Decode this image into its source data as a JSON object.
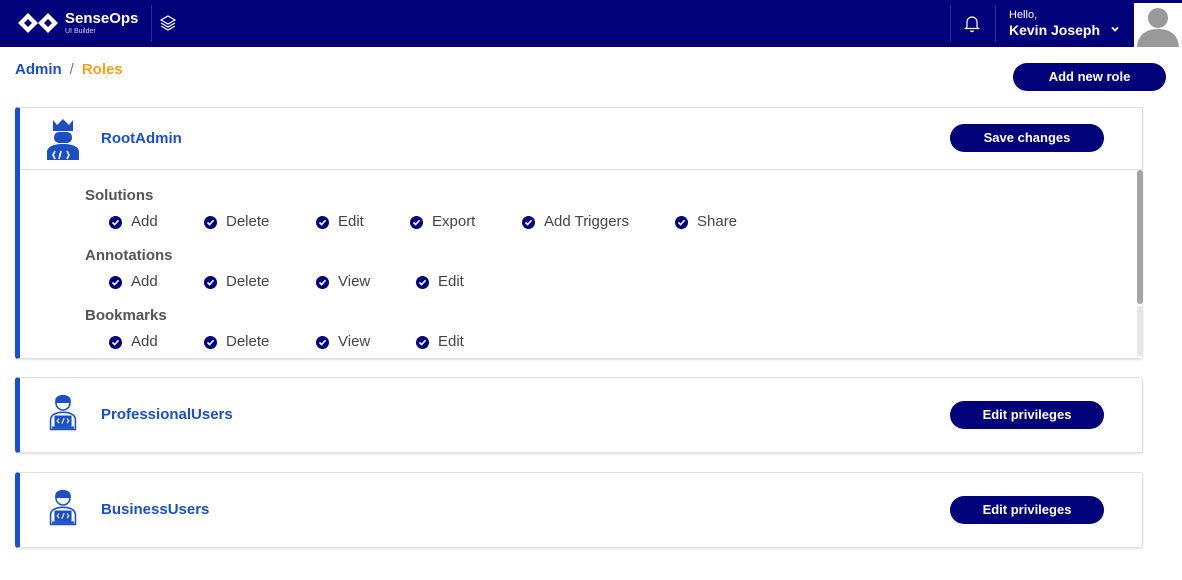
{
  "app": {
    "name": "SenseOps",
    "subtitle": "UI Builder"
  },
  "user": {
    "greeting": "Hello,",
    "name": "Kevin Joseph"
  },
  "breadcrumb": {
    "parent": "Admin",
    "separator": "/",
    "current": "Roles"
  },
  "actions": {
    "add_role_label": "Add new role"
  },
  "colors": {
    "navy": "#01017a",
    "blue": "#1d4fc4",
    "orange": "#f5a020"
  },
  "roles": [
    {
      "name": "RootAdmin",
      "icon": "admin-crown-icon",
      "button": "Save changes",
      "expanded": true,
      "groups": [
        {
          "title": "Solutions",
          "permissions": [
            "Add",
            "Delete",
            "Edit",
            "Export",
            "Add Triggers",
            "Share"
          ]
        },
        {
          "title": "Annotations",
          "permissions": [
            "Add",
            "Delete",
            "View",
            "Edit"
          ]
        },
        {
          "title": "Bookmarks",
          "permissions": [
            "Add",
            "Delete",
            "View",
            "Edit"
          ]
        }
      ]
    },
    {
      "name": "ProfessionalUsers",
      "icon": "developer-user-icon",
      "button": "Edit privileges",
      "expanded": false
    },
    {
      "name": "BusinessUsers",
      "icon": "developer-user-icon",
      "button": "Edit privileges",
      "expanded": false
    }
  ]
}
